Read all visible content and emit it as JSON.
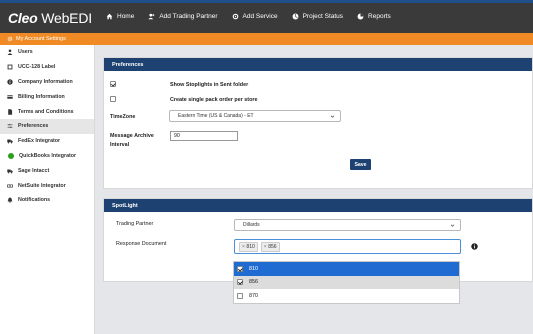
{
  "app": {
    "logo_bold": "Cleo",
    "logo_light": "WebEDI"
  },
  "nav": {
    "items": [
      {
        "label": "Home",
        "icon": "home-icon"
      },
      {
        "label": "Add Trading Partner",
        "icon": "add-partner-icon"
      },
      {
        "label": "Add Service",
        "icon": "add-service-icon"
      },
      {
        "label": "Project Status",
        "icon": "project-status-icon"
      },
      {
        "label": "Reports",
        "icon": "reports-icon"
      }
    ]
  },
  "account_bar": {
    "label": "My Account Settings",
    "icon": "gear-icon"
  },
  "sidebar": {
    "items": [
      {
        "label": "Users",
        "icon": "user-icon"
      },
      {
        "label": "UCC-128 Label",
        "icon": "barcode-icon"
      },
      {
        "label": "Company Information",
        "icon": "info-icon"
      },
      {
        "label": "Billing Information",
        "icon": "billing-icon"
      },
      {
        "label": "Terms and Conditions",
        "icon": "document-icon"
      },
      {
        "label": "Preferences",
        "icon": "sliders-icon"
      },
      {
        "label": "FedEx Integrator",
        "icon": "truck-icon"
      },
      {
        "label": "QuickBooks Integrator",
        "icon": "quickbooks-icon"
      },
      {
        "label": "Sage Intacct",
        "icon": "truck-icon"
      },
      {
        "label": "NetSuite Integrator",
        "icon": "link-icon"
      },
      {
        "label": "Notifications",
        "icon": "bell-icon"
      }
    ],
    "active_index": 5
  },
  "preferences": {
    "title": "Preferences",
    "stoplights_label": "Show Stoplights in Sent folder",
    "stoplights_checked": true,
    "single_pack_label": "Create single pack order per store",
    "single_pack_checked": false,
    "timezone_label": "TimeZone",
    "timezone_value": "Eastern Time (US & Canada) - ET",
    "archive_label_line1": "Message Archive",
    "archive_label_line2": "Interval",
    "archive_value": "90",
    "save_label": "Save"
  },
  "spotlight": {
    "title": "SpotLight",
    "trading_partner_label": "Trading Partner",
    "trading_partner_value": "Dillards",
    "response_label": "Response Document",
    "tags": [
      "810",
      "856"
    ],
    "tag_remove_glyph": "×",
    "options": [
      {
        "label": "810",
        "checked": true,
        "state": "highlight"
      },
      {
        "label": "856",
        "checked": true,
        "state": "selected"
      },
      {
        "label": "870",
        "checked": false,
        "state": "normal"
      }
    ]
  },
  "colors": {
    "topbar": "#3a3a3a",
    "accent_orange": "#f08a24",
    "panel_header": "#1d4170",
    "highlight_blue": "#1f6bd1"
  }
}
